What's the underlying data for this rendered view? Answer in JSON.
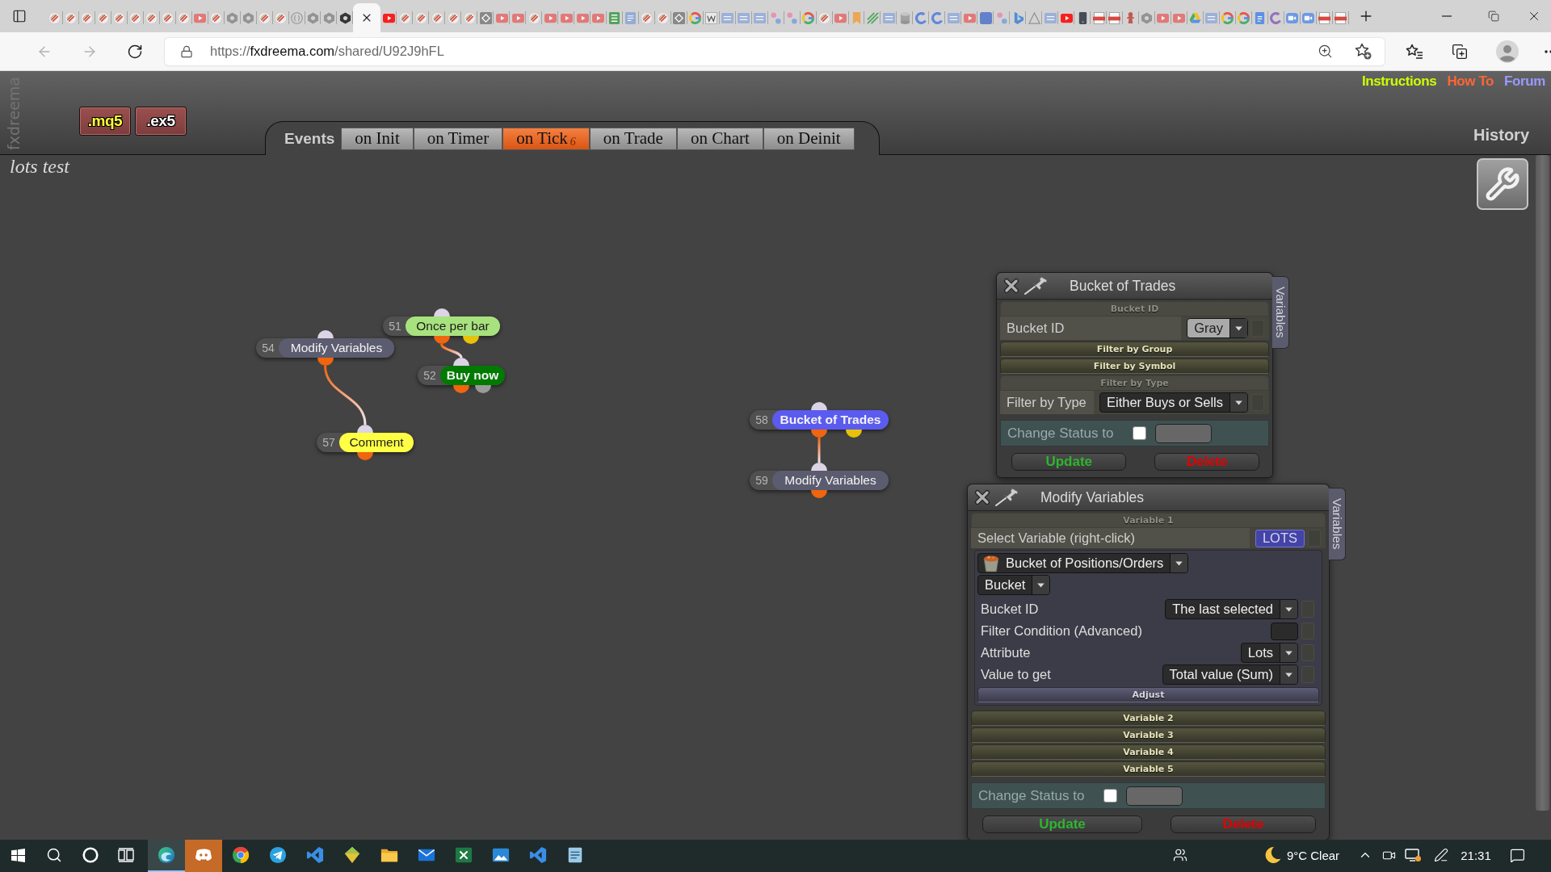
{
  "browser": {
    "tabs": [
      {
        "kind": "fx",
        "selected": false
      },
      {
        "kind": "fx",
        "selected": false
      },
      {
        "kind": "fx",
        "selected": false
      },
      {
        "kind": "fx",
        "selected": false
      },
      {
        "kind": "fx",
        "selected": false
      },
      {
        "kind": "fx",
        "selected": false
      },
      {
        "kind": "fx",
        "selected": false
      },
      {
        "kind": "fx",
        "selected": false
      },
      {
        "kind": "fx",
        "selected": false
      },
      {
        "kind": "play",
        "selected": false
      },
      {
        "kind": "fx",
        "selected": false
      },
      {
        "kind": "hex",
        "selected": false
      },
      {
        "kind": "hex",
        "selected": false
      },
      {
        "kind": "fx",
        "selected": false
      },
      {
        "kind": "fx",
        "selected": false
      },
      {
        "kind": "braces",
        "selected": false
      },
      {
        "kind": "hex",
        "selected": false
      },
      {
        "kind": "hex",
        "selected": false
      },
      {
        "kind": "hexdark",
        "selected": false
      },
      {
        "selected": true
      },
      {
        "kind": "yt",
        "selected": false
      },
      {
        "kind": "fx",
        "selected": false
      },
      {
        "kind": "fx",
        "selected": false
      },
      {
        "kind": "fx",
        "selected": false
      },
      {
        "kind": "fx",
        "selected": false
      },
      {
        "kind": "fx",
        "selected": false
      },
      {
        "kind": "code",
        "selected": false
      },
      {
        "kind": "play",
        "selected": false
      },
      {
        "kind": "play",
        "selected": false
      },
      {
        "kind": "fx",
        "selected": false
      },
      {
        "kind": "play",
        "selected": false
      },
      {
        "kind": "play",
        "selected": false
      },
      {
        "kind": "play",
        "selected": false
      },
      {
        "kind": "play",
        "selected": false
      },
      {
        "kind": "sheet",
        "selected": false
      },
      {
        "kind": "doc",
        "selected": false
      },
      {
        "kind": "fx",
        "selected": false
      },
      {
        "kind": "fx",
        "selected": false
      },
      {
        "kind": "code",
        "selected": false
      },
      {
        "kind": "google",
        "selected": false
      },
      {
        "kind": "wiki",
        "selected": false
      },
      {
        "kind": "mql",
        "selected": false
      },
      {
        "kind": "mql",
        "selected": false
      },
      {
        "kind": "mql",
        "selected": false
      },
      {
        "kind": "dots",
        "selected": false
      },
      {
        "kind": "dots",
        "selected": false
      },
      {
        "kind": "google",
        "selected": false
      },
      {
        "kind": "fx",
        "selected": false
      },
      {
        "kind": "play",
        "selected": false
      },
      {
        "kind": "bookmark",
        "selected": false
      },
      {
        "kind": "lines",
        "selected": false
      },
      {
        "kind": "mql",
        "selected": false
      },
      {
        "kind": "db",
        "selected": false
      },
      {
        "kind": "cring",
        "selected": false
      },
      {
        "kind": "cring",
        "selected": false
      },
      {
        "kind": "mql",
        "selected": false
      },
      {
        "kind": "play",
        "selected": false
      },
      {
        "kind": "fb",
        "selected": false
      },
      {
        "kind": "dots",
        "selected": false
      },
      {
        "kind": "bing",
        "selected": false
      },
      {
        "kind": "triangle",
        "selected": false
      },
      {
        "kind": "mql",
        "selected": false
      },
      {
        "kind": "yt",
        "selected": false
      },
      {
        "kind": "phone",
        "selected": false
      },
      {
        "kind": "pdf",
        "selected": false
      },
      {
        "kind": "pdf",
        "selected": false
      },
      {
        "kind": "figure",
        "selected": false
      },
      {
        "kind": "hex",
        "selected": false
      },
      {
        "kind": "play",
        "selected": false
      },
      {
        "kind": "play",
        "selected": false
      },
      {
        "kind": "drive",
        "selected": false
      },
      {
        "kind": "mql",
        "selected": false
      },
      {
        "kind": "google",
        "selected": false
      },
      {
        "kind": "google",
        "selected": false
      },
      {
        "kind": "docs",
        "selected": false
      },
      {
        "kind": "cpurple",
        "selected": false
      },
      {
        "kind": "zoom",
        "selected": false
      },
      {
        "kind": "zoom",
        "selected": false
      },
      {
        "kind": "pdf",
        "selected": false
      },
      {
        "kind": "pdf",
        "selected": false
      }
    ],
    "nav": [
      {
        "kind": "back",
        "disabled": true
      },
      {
        "kind": "forward",
        "disabled": true
      },
      {
        "kind": "reload",
        "disabled": false
      }
    ],
    "url": {
      "scheme": "https://",
      "host": "fxdreema.com",
      "path": "/shared/U92J9hFL"
    }
  },
  "app": {
    "logo": "fxdreema",
    "export_buttons": [
      {
        "kind": "source",
        "label": ".mq5"
      },
      {
        "kind": "compiled",
        "label": ".ex5"
      }
    ],
    "events": {
      "label": "Events",
      "tabs": [
        {
          "label": "on Init",
          "selected": false
        },
        {
          "label": "on Timer",
          "selected": false
        },
        {
          "label": "on Tick",
          "count": "6",
          "selected": true
        },
        {
          "label": "on Trade",
          "selected": false
        },
        {
          "label": "on Chart",
          "selected": false
        },
        {
          "label": "on Deinit",
          "selected": false
        }
      ]
    },
    "links": [
      {
        "label": "Instructions",
        "color": "#ccff00"
      },
      {
        "label": "How To",
        "color": "#ff6633"
      },
      {
        "label": "Forum",
        "color": "#9999ff"
      }
    ],
    "history": "History",
    "project_title": "lots test"
  },
  "nodes": [
    {
      "number": "51",
      "label": "Once per bar",
      "kind": "filter",
      "color": "#a8e27e",
      "outputs": [
        {
          "color": "#f0650e"
        },
        {
          "color": "#e8c10a"
        }
      ],
      "children": [
        {
          "number": "52",
          "label": "Buy now",
          "kind": "trade",
          "color": "#007a00",
          "outputs": [
            {
              "color": "#f0650e"
            },
            {
              "color": "#9a9a9a"
            }
          ]
        }
      ]
    },
    {
      "number": "54",
      "label": "Modify Variables",
      "kind": "variables",
      "color": "#5c5c70",
      "outputs": [
        {
          "color": "#f0650e"
        }
      ],
      "children": [
        {
          "number": "57",
          "label": "Comment",
          "kind": "output",
          "color": "#ffff44",
          "outputs": [
            {
              "color": "#f0650e"
            }
          ]
        }
      ]
    },
    {
      "number": "58",
      "label": "Bucket of Trades",
      "kind": "loop",
      "color": "#5b5bf0",
      "outputs": [
        {
          "color": "#f0650e"
        },
        {
          "color": "#e8c10a"
        }
      ],
      "children": [
        {
          "number": "59",
          "label": "Modify Variables",
          "kind": "variables",
          "color": "#5c5c70",
          "outputs": [
            {
              "color": "#f0650e"
            }
          ]
        }
      ]
    }
  ],
  "panels": [
    {
      "title": "Bucket of Trades",
      "side_tab": "Variables",
      "sections": [
        {
          "title": "Bucket ID",
          "expanded": true,
          "rows": [
            {
              "kind": "select",
              "label": "Bucket ID",
              "value": "Gray",
              "color": "#aaaaaa"
            }
          ]
        },
        {
          "title": "Filter by Group",
          "expanded": false
        },
        {
          "title": "Filter by Symbol",
          "expanded": false
        },
        {
          "title": "Filter by Type",
          "expanded": true,
          "rows": [
            {
              "kind": "select",
              "label": "Filter by Type",
              "value": "Either Buys or Sells"
            }
          ]
        }
      ],
      "status": {
        "label": "Change Status to",
        "checked": false
      },
      "buttons": [
        {
          "kind": "update",
          "label": "Update"
        },
        {
          "kind": "delete",
          "label": "Delete"
        }
      ]
    },
    {
      "title": "Modify Variables",
      "side_tab": "Variables",
      "sections": [
        {
          "title": "Variable 1",
          "expanded": true,
          "rows": [
            {
              "kind": "chip",
              "label": "Select Variable (right-click)",
              "value": "LOTS"
            },
            {
              "kind": "function",
              "category": "Bucket of Positions/Orders",
              "type": "Bucket",
              "rows": [
                {
                  "kind": "select",
                  "label": "Bucket ID",
                  "value": "The last selected"
                },
                {
                  "kind": "input",
                  "label": "Filter Condition (Advanced)"
                },
                {
                  "kind": "select",
                  "label": "Attribute",
                  "value": "Lots"
                },
                {
                  "kind": "select",
                  "label": "Value to get",
                  "value": "Total value (Sum)"
                }
              ],
              "sections": [
                {
                  "title": "Adjust",
                  "expanded": false
                }
              ]
            }
          ]
        },
        {
          "title": "Variable 2",
          "expanded": false
        },
        {
          "title": "Variable 3",
          "expanded": false
        },
        {
          "title": "Variable 4",
          "expanded": false
        },
        {
          "title": "Variable 5",
          "expanded": false
        }
      ],
      "status": {
        "label": "Change Status to",
        "checked": false
      },
      "buttons": [
        {
          "kind": "update",
          "label": "Update"
        },
        {
          "kind": "delete",
          "label": "Delete"
        }
      ]
    }
  ],
  "taskbar": {
    "apps": [
      {
        "kind": "edge",
        "active": true,
        "flashing": false
      },
      {
        "kind": "discord",
        "active": false,
        "flashing": true
      },
      {
        "kind": "chrome",
        "active": false,
        "flashing": false
      },
      {
        "kind": "telegram",
        "active": false,
        "flashing": false
      },
      {
        "kind": "ribbon",
        "active": false,
        "flashing": false
      },
      {
        "kind": "gem",
        "active": false,
        "flashing": false
      },
      {
        "kind": "explorer",
        "active": false,
        "flashing": false
      },
      {
        "kind": "mail",
        "active": false,
        "flashing": false
      },
      {
        "kind": "excel",
        "active": false,
        "flashing": false
      },
      {
        "kind": "photos",
        "active": false,
        "flashing": false
      },
      {
        "kind": "ribbon",
        "active": false,
        "flashing": false
      },
      {
        "kind": "notepad",
        "active": false,
        "flashing": false
      }
    ],
    "weather": "9°C Clear",
    "clock": "21:31"
  }
}
